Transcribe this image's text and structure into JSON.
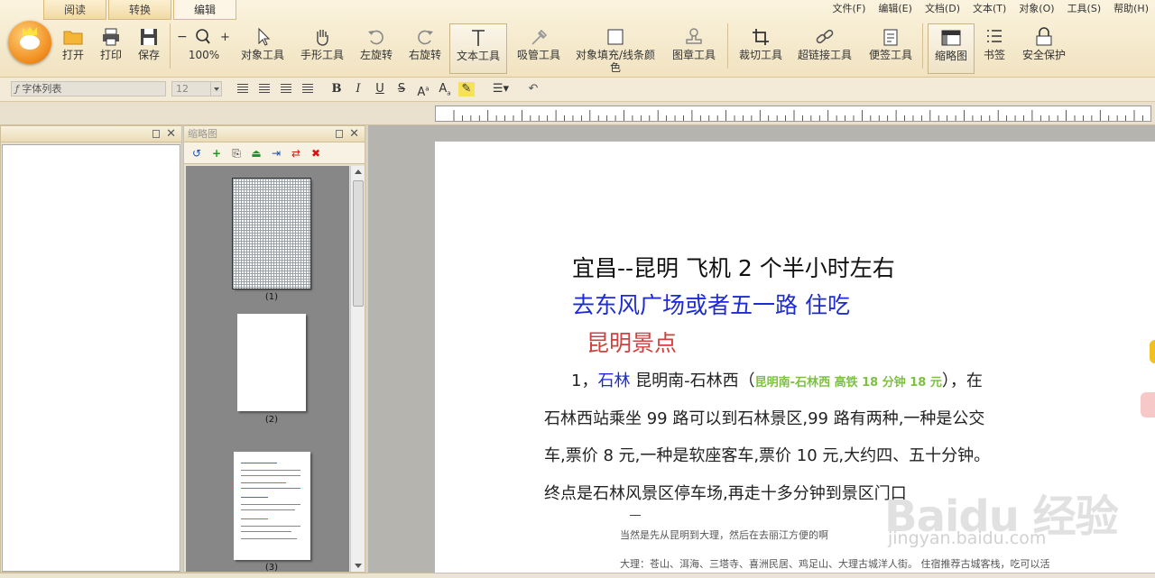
{
  "tabs": [
    "阅读",
    "转换",
    "编辑"
  ],
  "menu": [
    "文件(F)",
    "编辑(E)",
    "文档(D)",
    "文本(T)",
    "对象(O)",
    "工具(S)",
    "帮助(H)"
  ],
  "toolbar": {
    "open": "打开",
    "print": "打印",
    "save": "保存",
    "zoom": "100%",
    "object_tool": "对象工具",
    "hand_tool": "手形工具",
    "rotate_left": "左旋转",
    "rotate_right": "右旋转",
    "text_tool": "文本工具",
    "eyedropper": "吸管工具",
    "fill_line1": "对象填充/线条颜",
    "fill_line2": "色",
    "stamp": "图章工具",
    "crop": "裁切工具",
    "hyperlink": "超链接工具",
    "note": "便签工具",
    "thumbnail": "缩略图",
    "bookmark": "书签",
    "security": "安全保护"
  },
  "format": {
    "font_placeholder": "字体列表",
    "size": "12",
    "f_glyph": "ƒ"
  },
  "panels": {
    "left_title": "",
    "thumb_title": "缩略图"
  },
  "thumbnails": [
    "(1)",
    "(2)",
    "(3)"
  ],
  "document": {
    "line1": "宜昌--昆明  飞机 2 个半小时左右",
    "line2": "去东风广场或者五一路  住吃",
    "line3": "昆明景点",
    "p1_num": "1，",
    "p1_link": "石林",
    "p1_text": "   昆明南-石林西（",
    "p1_green": "昆明南-石林西  高铁  18 分钟 18 元",
    "p1_end": "），在",
    "p2": "石林西站乘坐 99 路可以到石林景区,99 路有两种,一种是公交",
    "p3": "车,票价 8 元,一种是软座客车,票价  10 元,大约四、五十分钟。",
    "p4": "终点是石林风景区停车场,再走十多分钟到景区门口",
    "note1": "当然是先从昆明到大理，然后在去丽江方便的啊",
    "note2": "大理：苍山、洱海、三塔寺、喜洲民居、鸡足山、大理古城洋人街。 住宿推荐古城客栈，吃可以活"
  },
  "watermark": {
    "main": "Baidu 经验",
    "url": "jingyan.baidu.com"
  }
}
